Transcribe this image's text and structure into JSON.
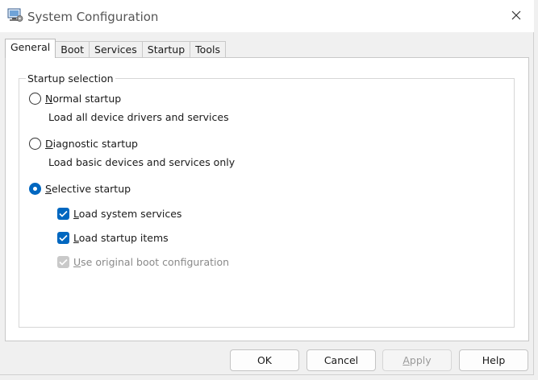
{
  "window": {
    "title": "System Configuration",
    "app_icon": "system-config-icon",
    "close_icon": "close-icon"
  },
  "tabs": [
    {
      "label": "General",
      "active": true
    },
    {
      "label": "Boot",
      "active": false
    },
    {
      "label": "Services",
      "active": false
    },
    {
      "label": "Startup",
      "active": false
    },
    {
      "label": "Tools",
      "active": false
    }
  ],
  "startup_selection": {
    "group_label": "Startup selection",
    "normal": {
      "mnemonic": "N",
      "label_rest": "ormal startup",
      "description": "Load all device drivers and services",
      "selected": false
    },
    "diagnostic": {
      "mnemonic": "D",
      "label_rest": "iagnostic startup",
      "description": "Load basic devices and services only",
      "selected": false
    },
    "selective": {
      "mnemonic": "S",
      "label_rest": "elective startup",
      "selected": true,
      "options": [
        {
          "mnemonic": "L",
          "label_rest": "oad system services",
          "checked": true,
          "enabled": true
        },
        {
          "mnemonic": "L",
          "label_rest": "oad startup items",
          "checked": true,
          "enabled": true
        },
        {
          "mnemonic": "U",
          "label_rest": "se original boot configuration",
          "checked": true,
          "enabled": false
        }
      ]
    }
  },
  "buttons": {
    "ok": "OK",
    "cancel": "Cancel",
    "apply_mnemonic": "A",
    "apply_rest": "pply",
    "apply_enabled": false,
    "help": "Help"
  },
  "colors": {
    "accent": "#0067c0",
    "disabled_check": "#c9c9c9"
  }
}
